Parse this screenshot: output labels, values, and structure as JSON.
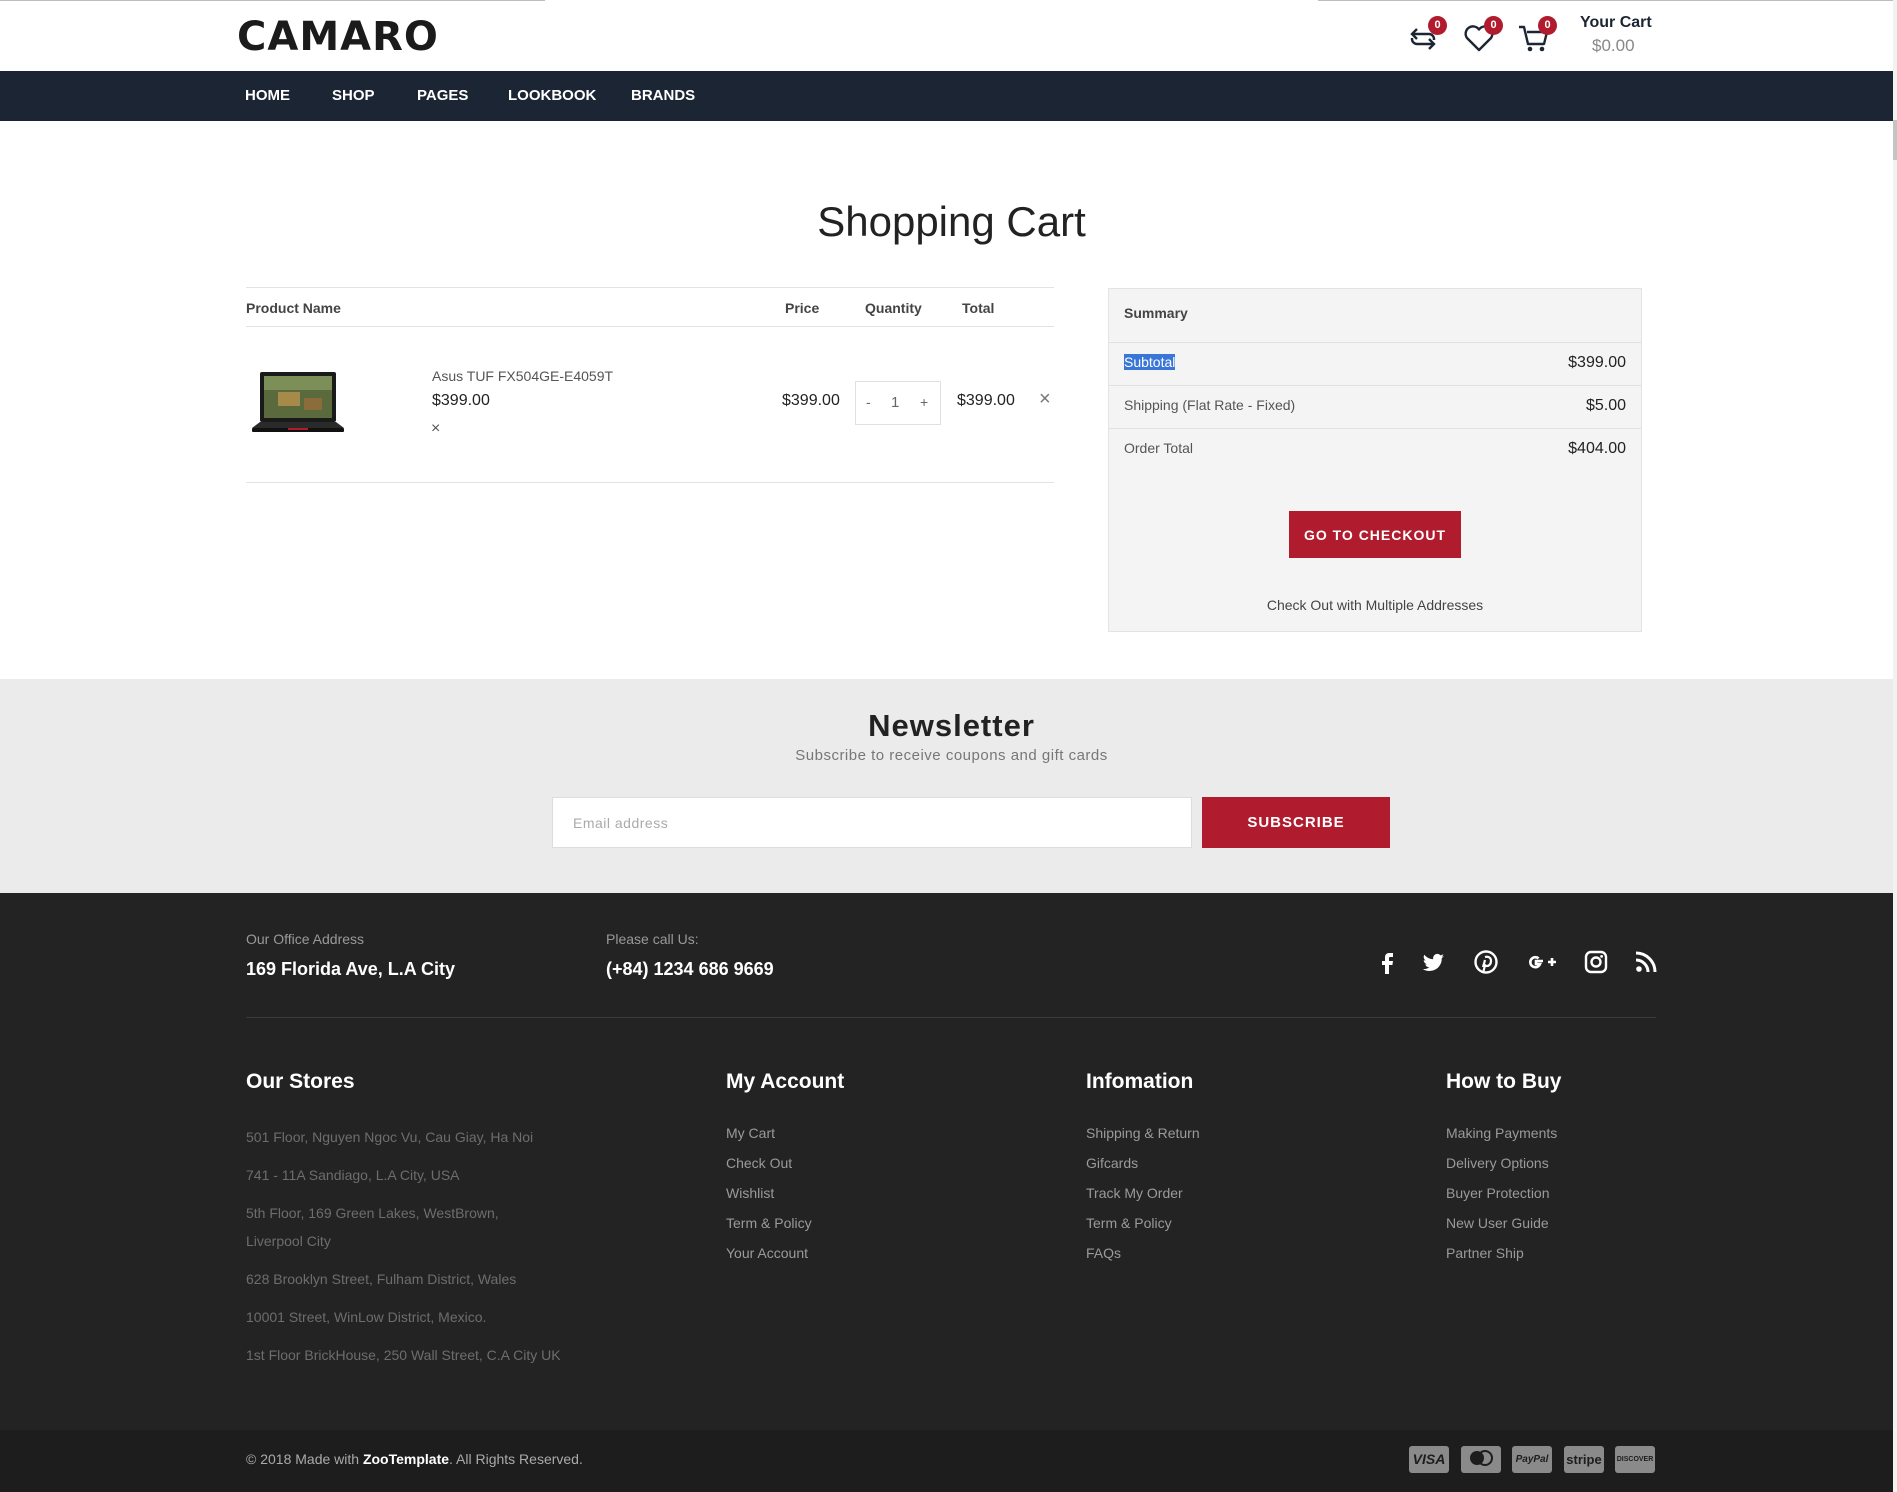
{
  "header": {
    "logo": "CAMARO",
    "compare_count": "0",
    "wishlist_count": "0",
    "cart_count": "0",
    "cart_title": "Your Cart",
    "cart_total": "$0.00"
  },
  "nav": {
    "items": [
      {
        "label": "HOME"
      },
      {
        "label": "SHOP"
      },
      {
        "label": "PAGES"
      },
      {
        "label": "LOOKBOOK"
      },
      {
        "label": "BRANDS"
      }
    ]
  },
  "cart": {
    "title": "Shopping Cart",
    "columns": {
      "product": "Product Name",
      "price": "Price",
      "quantity": "Quantity",
      "total": "Total"
    },
    "items": [
      {
        "name": "Asus TUF FX504GE-E4059T",
        "unit_price": "$399.00",
        "price": "$399.00",
        "qty_minus": "-",
        "quantity": "1",
        "qty_plus": "+",
        "total": "$399.00",
        "remove": "×"
      }
    ]
  },
  "summary": {
    "title": "Summary",
    "subtotal_label": "Subtotal",
    "subtotal_value": "$399.00",
    "shipping_label": "Shipping (Flat Rate - Fixed)",
    "shipping_value": "$5.00",
    "order_total_label": "Order Total",
    "order_total_value": "$404.00",
    "checkout_button": "GO TO CHECKOUT",
    "multi_address_link": "Check Out with Multiple Addresses"
  },
  "newsletter": {
    "title": "Newsletter",
    "subtitle": "Subscribe to receive coupons and gift cards",
    "email_placeholder": "Email address",
    "subscribe_button": "SUBSCRIBE"
  },
  "footer": {
    "office_label": "Our Office Address",
    "office_value": "169 Florida Ave, L.A City",
    "phone_label": "Please call Us:",
    "phone_value": "(+84) 1234 686 9669",
    "social": [
      "facebook-icon",
      "twitter-icon",
      "pinterest-icon",
      "google-plus-icon",
      "instagram-icon",
      "rss-icon"
    ],
    "stores": {
      "title": "Our Stores",
      "items": [
        "501 Floor, Nguyen Ngoc Vu, Cau Giay, Ha Noi",
        "741 - 11A Sandiago, L.A City, USA",
        "5th Floor, 169 Green Lakes, WestBrown, Liverpool City",
        "628 Brooklyn Street, Fulham District, Wales",
        "10001 Street, WinLow District, Mexico.",
        "1st Floor BrickHouse, 250 Wall Street, C.A City UK"
      ]
    },
    "account": {
      "title": "My Account",
      "links": [
        "My Cart",
        "Check Out",
        "Wishlist",
        "Term & Policy",
        "Your Account"
      ]
    },
    "information": {
      "title": "Infomation",
      "links": [
        "Shipping & Return",
        "Gifcards",
        "Track My Order",
        "Term & Policy",
        "FAQs"
      ]
    },
    "how_to_buy": {
      "title": "How to Buy",
      "links": [
        "Making Payments",
        "Delivery Options",
        "Buyer Protection",
        "New User Guide",
        "Partner Ship"
      ]
    },
    "copyright_prefix": "© 2018 Made with ",
    "copyright_brand": "ZooTemplate",
    "copyright_suffix": ". All Rights Reserved.",
    "payments": [
      "VISA",
      "mastercard",
      "PayPal",
      "stripe",
      "DISCOVER"
    ]
  },
  "colors": {
    "accent": "#b01c2e",
    "navbar": "#1c2533",
    "footer": "#232323",
    "newsletter_bg": "#ebebeb"
  }
}
